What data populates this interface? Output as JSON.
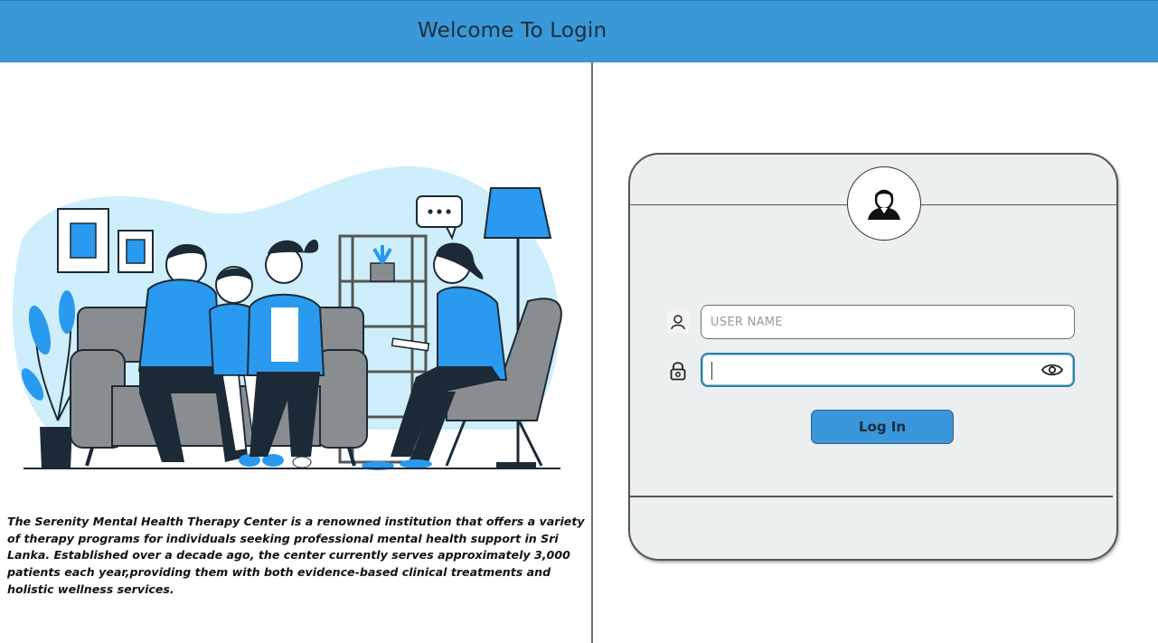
{
  "header": {
    "title": "Welcome To Login"
  },
  "left_panel": {
    "illustration": "therapy-session-illustration",
    "description": "The Serenity Mental Health Therapy Center is a renowned institution that offers a variety of therapy programs for individuals seeking professional mental health support in Sri Lanka. Established over a decade ago, the center currently serves approximately 3,000 patients each year,providing them with both evidence-based clinical treatments and holistic wellness services."
  },
  "login_card": {
    "avatar_icon": "user-avatar-icon",
    "username": {
      "icon": "user-icon",
      "placeholder": "USER NAME",
      "value": ""
    },
    "password": {
      "icon": "lock-icon",
      "value": "",
      "toggle_icon": "eye-icon"
    },
    "login_button": "Log In"
  },
  "colors": {
    "header_bg": "#3898d8",
    "card_bg": "#ecefef",
    "button_bg": "#3a97dc",
    "illustration_blue": "#2a9af0",
    "illustration_light_blue": "#cfeefc",
    "illustration_gray": "#8a8d90",
    "illustration_dark": "#1b2a36"
  }
}
